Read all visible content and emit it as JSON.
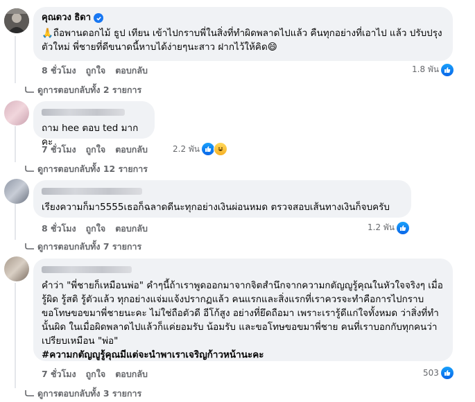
{
  "comments": [
    {
      "author": "คุณดวง ธิดา",
      "text": "🙏ถือพานดอกไม้ ธูป เทียน เข้าไปกราบพี่ในสิ่งที่ทำผิดพลาดไปแล้ว คืนทุกอย่างที่เอาไป แล้ว ปรับปรุงตัวใหม่ พี่ชายที่ดีขนาดนี้หาบได้ง่ายๆนะสาว ฝากไว้ให้คิด😄",
      "time": "8 ชั่วโมง",
      "like_label": "ถูกใจ",
      "reply_label": "ตอบกลับ",
      "reaction_count": "1.8 พัน",
      "replies": "ดูการตอบกลับทั้ง 2 รายการ"
    },
    {
      "text": "ถาม hee ตอบ ted มากคะ",
      "time": "7 ชั่วโมง",
      "like_label": "ถูกใจ",
      "reply_label": "ตอบกลับ",
      "reaction_count": "2.2 พัน",
      "replies": "ดูการตอบกลับทั้ง 12 รายการ"
    },
    {
      "text": "เรียงความก็มา5555เธอก็ฉลาดดีนะทุกอย่างเงินผ่อนหมด ตรวจสอบเส้นทางเงินก็จบครับ",
      "time": "8 ชั่วโมง",
      "like_label": "ถูกใจ",
      "reply_label": "ตอบกลับ",
      "reaction_count": "1.2 พัน",
      "replies": "ดูการตอบกลับทั้ง 7 รายการ"
    },
    {
      "text": "คำว่า \"พี่ชายก็เหมือนพ่อ\" คำๆนี้ถ้าเราพูดออกมาจากจิตสำนึกจากความกตัญญูรู้คุณในหัวใจจริงๆ เมื่อรู้ผิด รู้สติ รู้ตัวแล้ว ทุกอย่างแจ่มแจ้งปรากฏแล้ว คนแรกและสิ่งแรกที่เราควรจะทำคือการไปกราบขอโทษขอขมาพี่ชายนะคะ ไม่ใช่ถือตัวดี อีโก้สูง อย่างที่ยึดถือมา เพราะเรารู้ดีแก่ใจทั้งหมด ว่าสิ่งที่ทำนั้นผิด ในเมื่อผิดพลาดไปแล้วก็แค่ยอมรับ น้อมรับ และขอโทษขอขมาพี่ชาย คนที่เราบอกกับทุกคนว่าเปรียบเหมือน \"พ่อ\"",
      "hashtag": "#ความกตัญญูรู้คุณมีแต่จะนำพาเราเจริญก้าวหน้านะคะ",
      "time": "7 ชั่วโมง",
      "like_label": "ถูกใจ",
      "reply_label": "ตอบกลับ",
      "reaction_count": "503",
      "replies": "ดูการตอบกลับทั้ง 3 รายการ"
    }
  ],
  "colors": {
    "like_blue": "#1877f2",
    "bubble_bg": "#f0f2f5",
    "meta_gray": "#65676b"
  }
}
